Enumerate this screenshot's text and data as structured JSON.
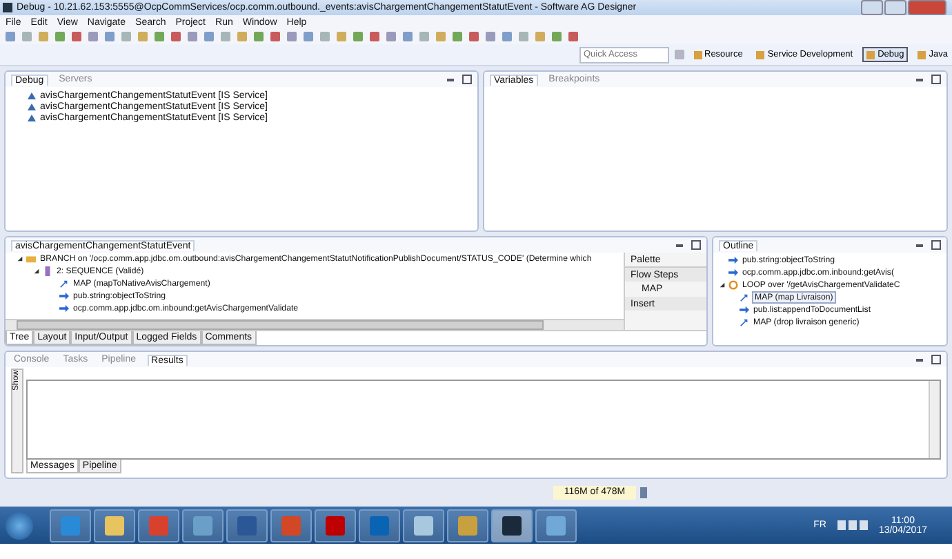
{
  "window": {
    "title": "Debug - 10.21.62.153:5555@OcpCommServices/ocp.comm.outbound._events:avisChargementChangementStatutEvent - Software AG Designer"
  },
  "menu": [
    "File",
    "Edit",
    "View",
    "Navigate",
    "Search",
    "Project",
    "Run",
    "Window",
    "Help"
  ],
  "quick_access": {
    "placeholder": "Quick Access"
  },
  "perspectives": [
    {
      "label": "Resource",
      "selected": false
    },
    {
      "label": "Service Development",
      "selected": false
    },
    {
      "label": "Debug",
      "selected": true
    },
    {
      "label": "Java",
      "selected": false
    }
  ],
  "debug_panel": {
    "tabs": [
      {
        "label": "Debug",
        "selected": true
      },
      {
        "label": "Servers",
        "selected": false
      }
    ],
    "items": [
      "avisChargementChangementStatutEvent [IS Service]",
      "avisChargementChangementStatutEvent [IS Service]",
      "avisChargementChangementStatutEvent [IS Service]"
    ]
  },
  "variables_panel": {
    "tabs": [
      {
        "label": "Variables",
        "selected": true
      },
      {
        "label": "Breakpoints",
        "selected": false
      }
    ]
  },
  "editor": {
    "tab": "avisChargementChangementStatutEvent",
    "tree": [
      {
        "kind": "branch",
        "label": "BRANCH on '/ocp.comm.app.jdbc.om.outbound:avisChargementChangementStatutNotificationPublishDocument/STATUS_CODE' (Determine which",
        "expanded": true,
        "children": [
          {
            "kind": "sequence",
            "label": "2: SEQUENCE (Validé)",
            "expanded": true,
            "children": [
              {
                "kind": "map",
                "label": "MAP (mapToNativeAvisChargement)"
              },
              {
                "kind": "invoke",
                "label": "pub.string:objectToString"
              },
              {
                "kind": "invoke",
                "label": "ocp.comm.app.jdbc.om.inbound:getAvisChargementValidate"
              }
            ]
          }
        ]
      }
    ],
    "palette": {
      "title": "Palette",
      "groups": [
        {
          "label": "Flow Steps",
          "items": [
            "MAP"
          ]
        },
        {
          "label": "Insert"
        }
      ]
    },
    "bottom_tabs": [
      {
        "label": "Tree",
        "selected": true
      },
      {
        "label": "Layout",
        "selected": false
      },
      {
        "label": "Input/Output",
        "selected": false
      },
      {
        "label": "Logged Fields",
        "selected": false
      },
      {
        "label": "Comments",
        "selected": false
      }
    ]
  },
  "outline": {
    "tab": "Outline",
    "tree": [
      {
        "kind": "invoke",
        "label": "pub.string:objectToString",
        "selected": false
      },
      {
        "kind": "invoke",
        "label": "ocp.comm.app.jdbc.om.inbound:getAvis(",
        "selected": false
      },
      {
        "kind": "loop",
        "label": "LOOP over '/getAvisChargementValidateC",
        "selected": false,
        "expanded": true,
        "children": [
          {
            "kind": "map",
            "label": "MAP (map Livraison)",
            "selected": true
          },
          {
            "kind": "invoke",
            "label": "pub.list:appendToDocumentList",
            "selected": false
          },
          {
            "kind": "map",
            "label": "MAP (drop livraison generic)",
            "selected": false
          }
        ]
      }
    ]
  },
  "results_panel": {
    "tabs": [
      {
        "label": "Console",
        "selected": false
      },
      {
        "label": "Tasks",
        "selected": false
      },
      {
        "label": "Pipeline",
        "selected": false
      },
      {
        "label": "Results",
        "selected": true
      }
    ],
    "side_label": "Show",
    "bottom_tabs": [
      {
        "label": "Messages",
        "selected": true
      },
      {
        "label": "Pipeline",
        "selected": false
      }
    ]
  },
  "status": {
    "memory": "116M of 478M"
  },
  "taskbar": {
    "apps": [
      {
        "kind": "ie",
        "selected": false
      },
      {
        "kind": "folder",
        "selected": false
      },
      {
        "kind": "chrome",
        "selected": false
      },
      {
        "kind": "media",
        "selected": false
      },
      {
        "kind": "word",
        "selected": false
      },
      {
        "kind": "powerpoint",
        "selected": false
      },
      {
        "kind": "filezilla",
        "selected": false
      },
      {
        "kind": "outlook",
        "selected": false
      },
      {
        "kind": "notepad",
        "selected": false
      },
      {
        "kind": "tools",
        "selected": false
      },
      {
        "kind": "circle",
        "selected": true
      },
      {
        "kind": "paint",
        "selected": false
      }
    ],
    "language": "FR",
    "time": "11:00",
    "date": "13/04/2017"
  }
}
